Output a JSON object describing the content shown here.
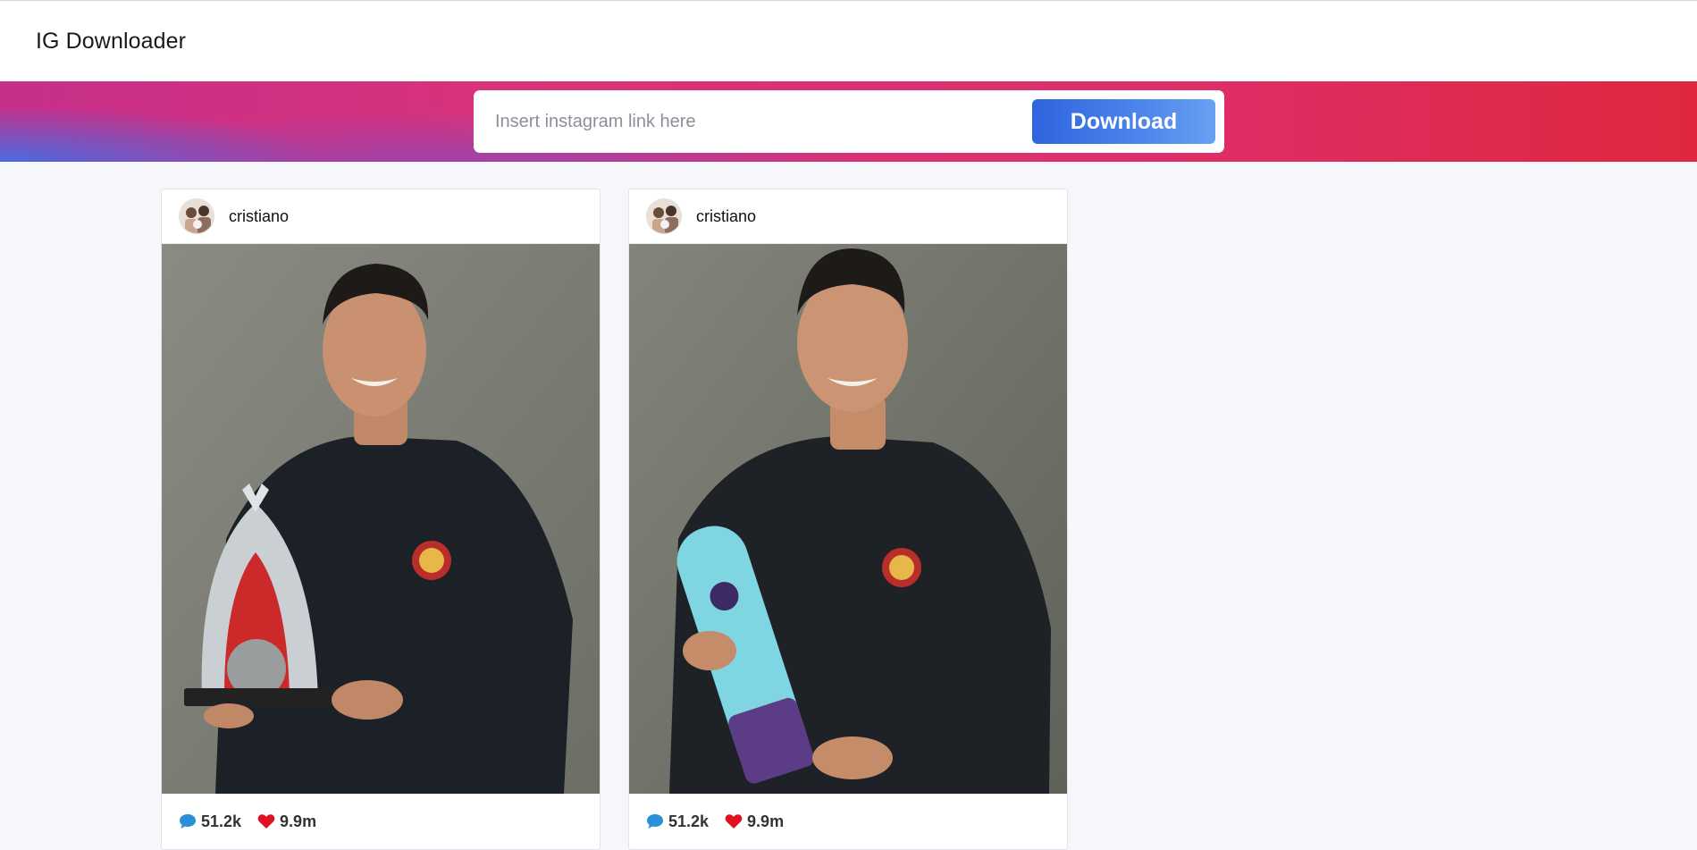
{
  "navbar": {
    "brand": "IG Downloader"
  },
  "search": {
    "placeholder": "Insert instagram link here",
    "value": "",
    "button_label": "Download"
  },
  "posts": [
    {
      "username": "cristiano",
      "comments": "51.2k",
      "likes": "9.9m",
      "comment_icon": "comment-icon",
      "like_icon": "heart-icon"
    },
    {
      "username": "cristiano",
      "comments": "51.2k",
      "likes": "9.9m",
      "comment_icon": "comment-icon",
      "like_icon": "heart-icon"
    }
  ],
  "colors": {
    "button": "#3b74e6",
    "comment_icon": "#2b8fd6",
    "heart_icon": "#e0101f"
  }
}
